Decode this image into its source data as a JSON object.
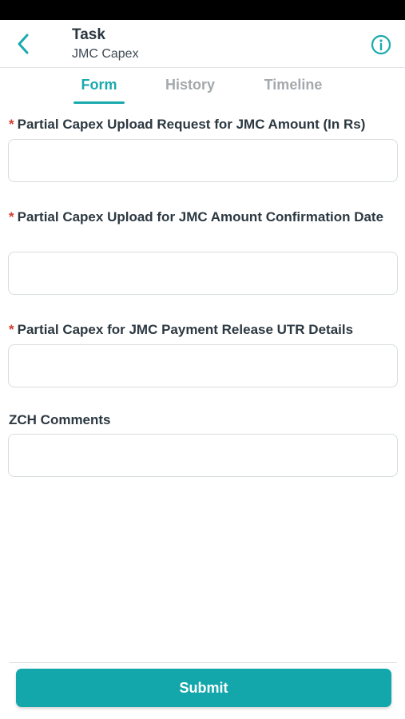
{
  "header": {
    "title": "Task",
    "subtitle": "JMC Capex"
  },
  "tabs": [
    {
      "label": "Form",
      "active": true
    },
    {
      "label": "History",
      "active": false
    },
    {
      "label": "Timeline",
      "active": false
    }
  ],
  "form": {
    "required_marker": "*",
    "fields": [
      {
        "label": "Partial Capex Upload Request for JMC Amount (In Rs)",
        "required": true,
        "value": ""
      },
      {
        "label": "Partial Capex Upload for JMC Amount Confirmation Date",
        "required": true,
        "value": ""
      },
      {
        "label": "Partial Capex for JMC Payment Release UTR Details",
        "required": true,
        "value": ""
      },
      {
        "label": "ZCH Comments",
        "required": false,
        "value": ""
      }
    ]
  },
  "actions": {
    "submit_label": "Submit"
  },
  "colors": {
    "accent": "#1aa9ad",
    "required": "#d63a2f",
    "tab_inactive": "#a3a9ad"
  },
  "icons": {
    "back": "chevron-left-icon",
    "info": "info-circle-icon"
  }
}
